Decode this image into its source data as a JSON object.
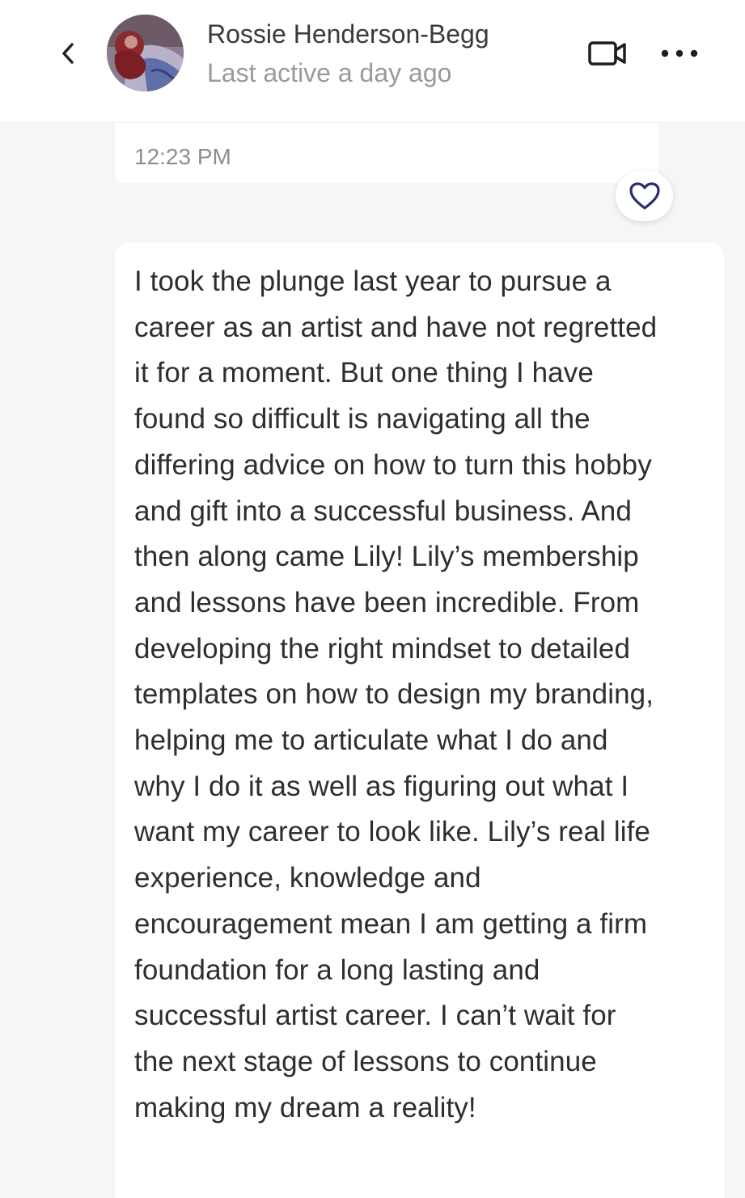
{
  "header": {
    "contact_name": "Rossie Henderson-Begg",
    "status": "Last active a day ago",
    "back_icon": "chevron-left-icon",
    "video_icon": "video-camera-icon",
    "more_icon": "more-horizontal-icon"
  },
  "previous_message": {
    "time": "12:23 PM"
  },
  "reaction": {
    "icon": "heart-icon",
    "color": "#2a2f6b"
  },
  "message": {
    "lines": [
      "I took the plunge last year to pursue a",
      "career as an artist and have not regretted",
      "it for a moment. But one thing I have",
      "found so difficult is navigating all the",
      "differing advice on how to turn this hobby",
      "and gift into a successful business. And",
      "then along came Lily! Lily’s membership",
      "and lessons have been incredible. From",
      "developing the right mindset to detailed",
      "templates on how to design my branding,",
      "helping me to articulate what I do and",
      "why I do it as well as figuring out what I",
      "want my career to look like. Lily’s real life",
      "experience, knowledge and",
      "encouragement mean I am getting a firm",
      "foundation for a long lasting and",
      "successful artist career. I can’t wait for",
      "the next stage of lessons to continue",
      "making my dream a reality!"
    ]
  }
}
